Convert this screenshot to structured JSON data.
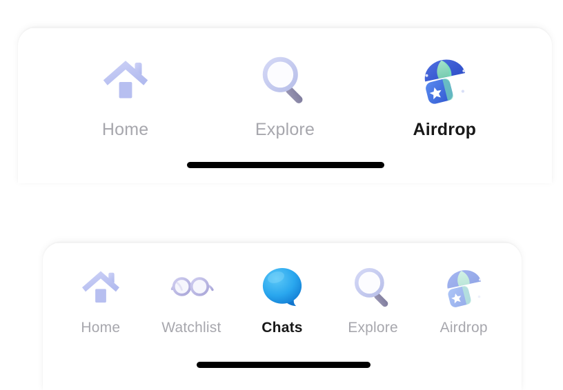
{
  "screen": {
    "background_color": "#ffffff",
    "description": "Mobile app bottom tab bar variants"
  },
  "top_tabbar": {
    "name": "three-tab-bar",
    "active_index": 2,
    "tabs": [
      {
        "label": "Home",
        "icon": "home-icon",
        "active": false
      },
      {
        "label": "Explore",
        "icon": "search-icon",
        "active": false
      },
      {
        "label": "Airdrop",
        "icon": "parachute-gift-icon",
        "active": true
      }
    ],
    "home_indicator": "home-indicator-bar"
  },
  "bottom_tabbar": {
    "name": "five-tab-bar",
    "active_index": 2,
    "tabs": [
      {
        "label": "Home",
        "icon": "home-icon",
        "active": false
      },
      {
        "label": "Watchlist",
        "icon": "glasses-icon",
        "active": false
      },
      {
        "label": "Chats",
        "icon": "speech-bubble-icon",
        "active": true
      },
      {
        "label": "Explore",
        "icon": "search-icon",
        "active": false
      },
      {
        "label": "Airdrop",
        "icon": "parachute-gift-icon",
        "active": false
      }
    ],
    "home_indicator": "home-indicator-bar"
  },
  "colors": {
    "label_inactive": "#a7a7ad",
    "label_active": "#181818",
    "icon_lavender": "#c3c8f2",
    "icon_periwinkle": "#aeb6ef",
    "icon_handle": "#8d8aa8",
    "chat_blue_light": "#45b6f2",
    "chat_blue_dark": "#1a86d9",
    "parachute_blue": "#3b5fd6",
    "parachute_green": "#8fd9c0",
    "gift_blue": "#4a7ee8",
    "home_indicator": "#000000",
    "card_background": "#ffffff"
  }
}
